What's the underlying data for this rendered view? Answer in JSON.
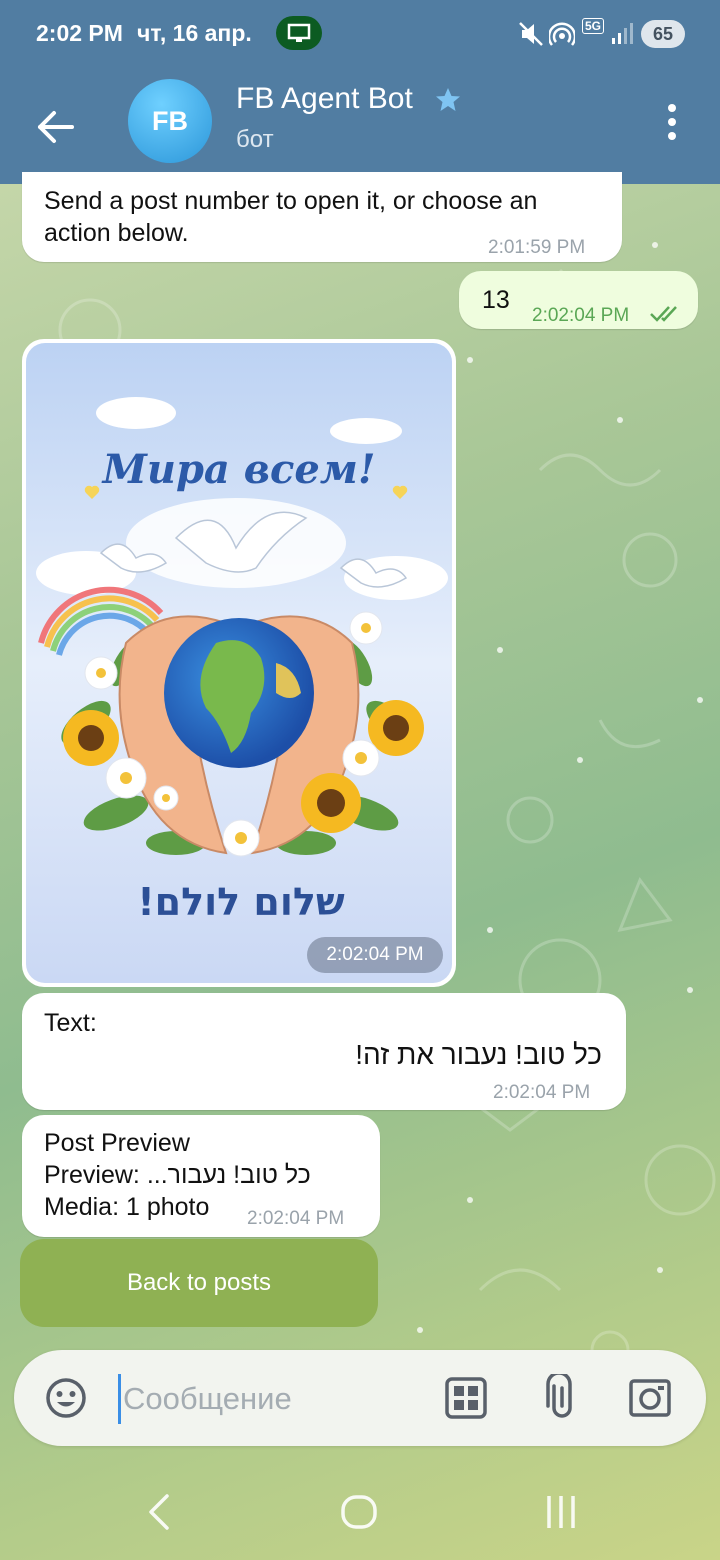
{
  "status_bar": {
    "time": "2:02 PM",
    "date": "чт, 16 апр.",
    "battery": "65",
    "network": "5G"
  },
  "header": {
    "avatar_initials": "FB",
    "title": "FB Agent Bot",
    "subtitle": "бот"
  },
  "messages": [
    {
      "id": "m1",
      "direction": "in",
      "lines": [
        "Send a post number to open it, or choose an",
        "action below."
      ],
      "time": "2:01:59 PM"
    },
    {
      "id": "m2",
      "direction": "out",
      "text": "13",
      "time": "2:02:04 PM",
      "read": true
    },
    {
      "id": "m3",
      "direction": "in",
      "type": "photo",
      "photo_caption_top": "Мира всем!",
      "photo_caption_bottom": "שלום לולם!",
      "time": "2:02:04 PM"
    },
    {
      "id": "m4",
      "direction": "in",
      "label": "Text:",
      "text_rtl": "כל טוב! נעבור את זה!",
      "time": "2:02:04 PM"
    },
    {
      "id": "m5",
      "direction": "in",
      "line1": "Post Preview",
      "line2_label": "Preview: ",
      "line2_value": "כל טוב! נעבור...",
      "line3": "Media: 1 photo",
      "time": "2:02:04 PM"
    }
  ],
  "keyboard": {
    "buttons": [
      "Back to posts"
    ]
  },
  "composer": {
    "placeholder": "Сообщение",
    "value": ""
  },
  "colors": {
    "header": "#517da2",
    "accent": "#3a8ee6",
    "out_bubble": "#effdde",
    "kb_button": "#8fb153"
  }
}
